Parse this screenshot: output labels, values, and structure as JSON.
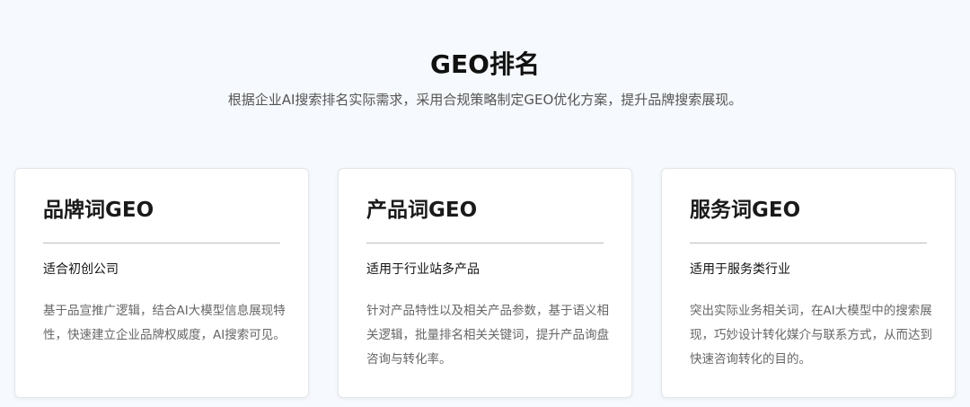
{
  "header": {
    "title": "GEO排名",
    "subtitle": "根据企业AI搜索排名实际需求，采用合规策略制定GEO优化方案，提升品牌搜索展现。"
  },
  "cards": [
    {
      "title": "品牌词GEO",
      "subtitle": "适合初创公司",
      "description": "基于品宣推广逻辑，结合AI大模型信息展现特性，快速建立企业品牌权威度，AI搜索可见。"
    },
    {
      "title": "产品词GEO",
      "subtitle": "适用于行业站多产品",
      "description": "针对产品特性以及相关产品参数，基于语义相关逻辑，批量排名相关关键词，提升产品询盘咨询与转化率。"
    },
    {
      "title": "服务词GEO",
      "subtitle": "适用于服务类行业",
      "description": "突出实际业务相关词，在AI大模型中的搜索展现，巧妙设计转化媒介与联系方式，从而达到快速咨询转化的目的。"
    }
  ]
}
